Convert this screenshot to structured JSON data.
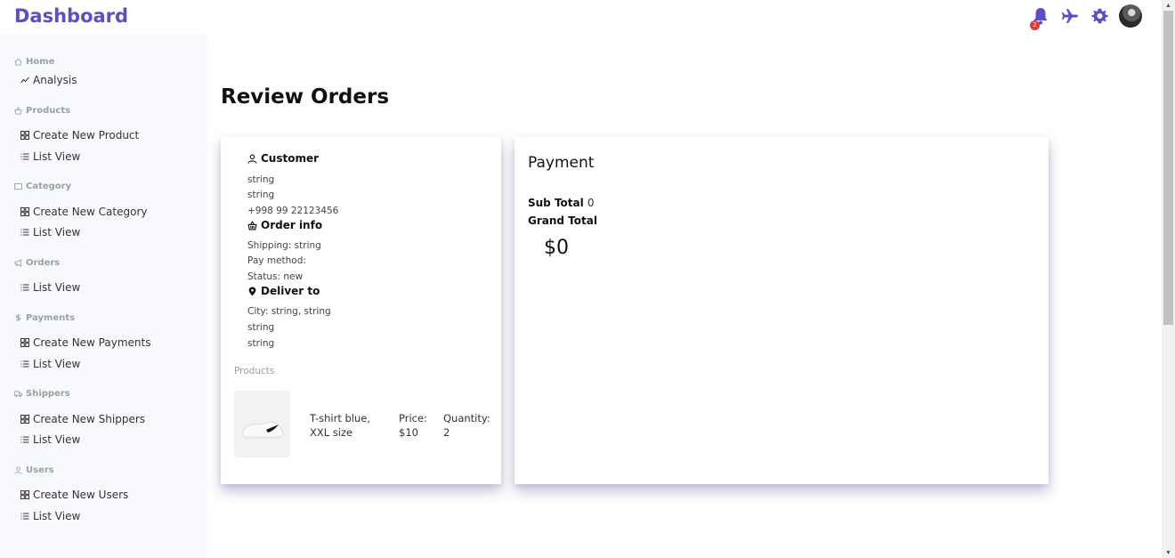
{
  "header": {
    "brand": "Dashboard",
    "notification_count": "2",
    "accent_color": "#5b4fc7",
    "icons": [
      "bell-icon",
      "plane-icon",
      "gear-icon",
      "avatar"
    ]
  },
  "sidebar": {
    "sections": [
      {
        "title": "Home",
        "icon": "home-icon",
        "items": [
          {
            "label": "Analysis",
            "icon": "chart-line-icon"
          }
        ]
      },
      {
        "title": "Products",
        "icon": "basket-icon",
        "items": [
          {
            "label": "Create New Product",
            "icon": "grid-icon"
          },
          {
            "label": "List View",
            "icon": "list-icon"
          }
        ]
      },
      {
        "title": "Category",
        "icon": "square-icon",
        "items": [
          {
            "label": "Create New Category",
            "icon": "grid-icon"
          },
          {
            "label": "List View",
            "icon": "list-icon"
          }
        ]
      },
      {
        "title": "Orders",
        "icon": "megaphone-icon",
        "items": [
          {
            "label": "List View",
            "icon": "list-icon"
          }
        ]
      },
      {
        "title": "Payments",
        "icon": "dollar-icon",
        "items": [
          {
            "label": "Create New Payments",
            "icon": "grid-icon"
          },
          {
            "label": "List View",
            "icon": "list-icon"
          }
        ]
      },
      {
        "title": "Shippers",
        "icon": "truck-icon",
        "items": [
          {
            "label": "Create New Shippers",
            "icon": "grid-icon"
          },
          {
            "label": "List View",
            "icon": "list-icon"
          }
        ]
      },
      {
        "title": "Users",
        "icon": "user-icon",
        "items": [
          {
            "label": "Create New Users",
            "icon": "grid-icon"
          },
          {
            "label": "List View",
            "icon": "list-icon"
          }
        ]
      }
    ]
  },
  "main": {
    "title": "Review Orders",
    "customer": {
      "heading": "Customer",
      "lines": [
        "string",
        "string",
        "+998 99 22123456"
      ]
    },
    "order_info": {
      "heading": "Order info",
      "lines": [
        "Shipping: string",
        "Pay method:",
        "Status: new"
      ]
    },
    "deliver_to": {
      "heading": "Deliver to",
      "lines": [
        "City: string, string",
        "string",
        "string"
      ]
    },
    "products_label": "Products",
    "product": {
      "name": "T-shirt blue, XXL size",
      "price": "Price: $10",
      "quantity": "Quantity: 2"
    },
    "payment": {
      "title": "Payment",
      "sub_total_label": "Sub Total",
      "sub_total_value": "0",
      "grand_total_label": "Grand Total",
      "grand_total_value": "$0"
    }
  }
}
